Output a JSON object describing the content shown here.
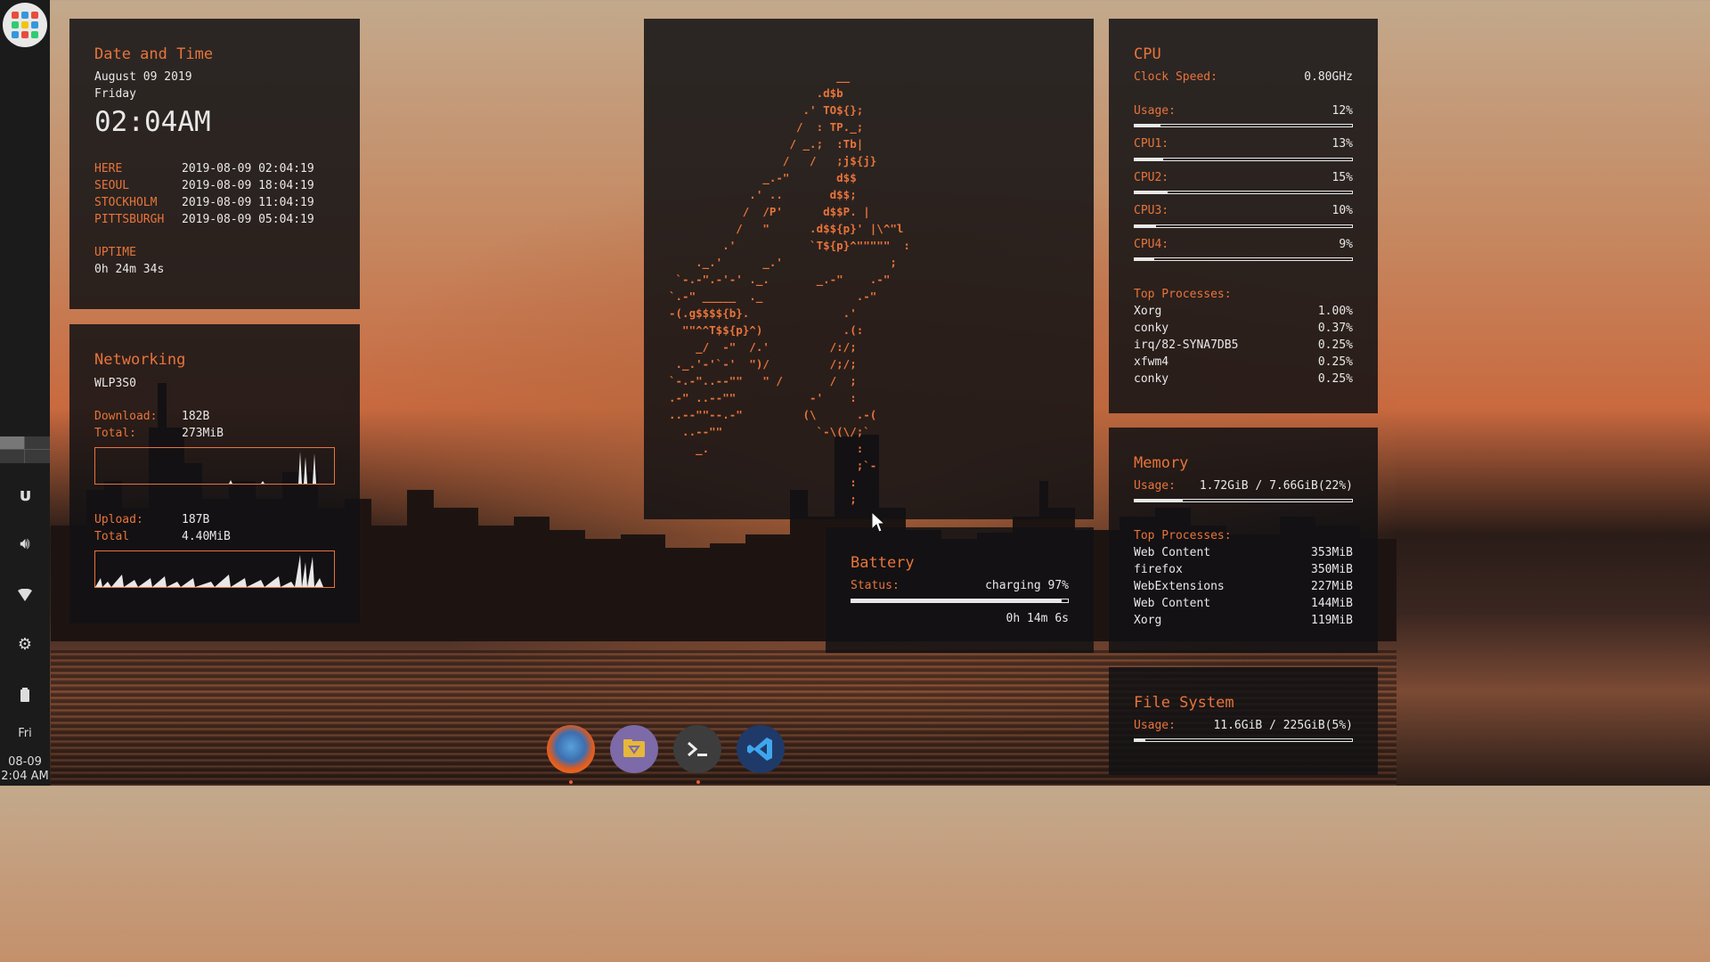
{
  "datetime": {
    "title": "Date and Time",
    "date": "August 09 2019",
    "weekday": "Friday",
    "time": "02:04AM",
    "zones": [
      {
        "name": "HERE",
        "value": "2019-08-09 02:04:19"
      },
      {
        "name": "SEOUL",
        "value": "2019-08-09 18:04:19"
      },
      {
        "name": "STOCKHOLM",
        "value": "2019-08-09 11:04:19"
      },
      {
        "name": "PITTSBURGH",
        "value": "2019-08-09 05:04:19"
      }
    ],
    "uptime_label": "UPTIME",
    "uptime": "0h 24m 34s"
  },
  "network": {
    "title": "Networking",
    "interface": "WLP3S0",
    "download_label": "Download:",
    "download": "182B",
    "download_total_label": "Total:",
    "download_total": "273MiB",
    "upload_label": "Upload:",
    "upload": "187B",
    "upload_total_label": "Total",
    "upload_total": "4.40MiB"
  },
  "ascii_art": "                         __\n                      .d$b\n                    .' TO${};\n                   /  : TP._;\n                  / _.;  :Tb|\n                 /   /   ;j${j}\n              _.-\"       d$$\n            .' ..       d$$;\n           /  /P'      d$$P. |\n          /   \"      .d$${p}' |\\^\"l\n        .'           `T${p}^\"\"\"\"\"  :\n    ._.'      _.'                ;\n `-.-\".-'-' ._.       _.-\"    .-\"\n`.-\" _____  ._              .-\"\n-(.g$$$${b}.              .'\n  \"\"^^T$${p}^)            .(:\n    _/  -\"  /.'         /:/;\n ._.'-'`-'  \")/         /;/;\n`-.-\"..--\"\"   \" /       /  ;\n.-\" ..--\"\"           -'    :\n..--\"\"--.-\"         (\\      .-(\n  ..--\"\"              `-\\(\\/;`\n    _.                      :\n                            ;`-\n                           :\n                           ;",
  "cpu": {
    "title": "CPU",
    "clock_label": "Clock Speed:",
    "clock": "0.80GHz",
    "rows": [
      {
        "label": "Usage:",
        "value": "12%",
        "pct": 12
      },
      {
        "label": "CPU1:",
        "value": "13%",
        "pct": 13
      },
      {
        "label": "CPU2:",
        "value": "15%",
        "pct": 15
      },
      {
        "label": "CPU3:",
        "value": "10%",
        "pct": 10
      },
      {
        "label": "CPU4:",
        "value": "9%",
        "pct": 9
      }
    ],
    "top_label": "Top Processes:",
    "top": [
      {
        "name": "Xorg",
        "value": "1.00%"
      },
      {
        "name": "conky",
        "value": "0.37%"
      },
      {
        "name": "irq/82-SYNA7DB5",
        "value": "0.25%"
      },
      {
        "name": "xfwm4",
        "value": "0.25%"
      },
      {
        "name": "conky",
        "value": "0.25%"
      }
    ]
  },
  "battery": {
    "title": "Battery",
    "status_label": "Status:",
    "status": "charging 97%",
    "pct": 97,
    "remaining": "0h 14m 6s"
  },
  "memory": {
    "title": "Memory",
    "usage_label": "Usage:",
    "usage": "1.72GiB / 7.66GiB(22%)",
    "pct": 22,
    "top_label": "Top Processes:",
    "top": [
      {
        "name": "Web Content",
        "value": "353MiB"
      },
      {
        "name": "firefox",
        "value": "350MiB"
      },
      {
        "name": "WebExtensions",
        "value": "227MiB"
      },
      {
        "name": "Web Content",
        "value": "144MiB"
      },
      {
        "name": "Xorg",
        "value": "119MiB"
      }
    ]
  },
  "filesystem": {
    "title": "File System",
    "usage_label": "Usage:",
    "usage": "11.6GiB / 225GiB(5%)",
    "pct": 5
  },
  "sidebar": {
    "day": "Fri",
    "date": "08-09",
    "time": "2:04 AM",
    "icons": [
      "ulauncher-icon",
      "volume-icon",
      "wifi-icon",
      "settings-icon",
      "battery-icon"
    ]
  },
  "dock": {
    "apps": [
      "firefox-icon",
      "file-manager-icon",
      "terminal-icon",
      "vscode-icon"
    ]
  },
  "colors": {
    "accent": "#e8743b",
    "panel": "#121214",
    "text": "#e8e8e8"
  }
}
